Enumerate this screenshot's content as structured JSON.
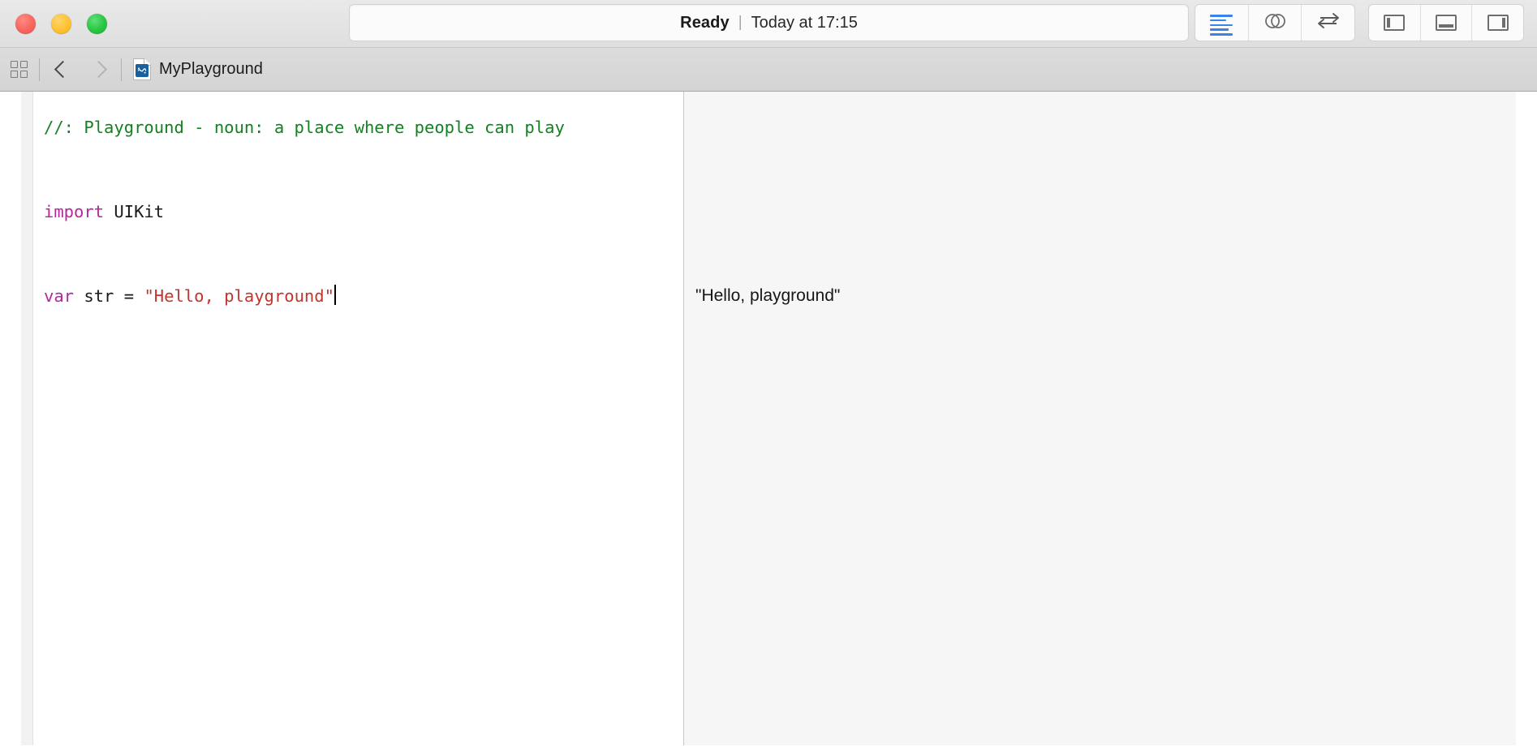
{
  "window": {
    "traffic_lights": [
      {
        "name": "close",
        "color": "#f7645c",
        "label": "Close"
      },
      {
        "name": "minimize",
        "color": "#fec12f",
        "label": "Minimize"
      },
      {
        "name": "zoom",
        "color": "#28c53f",
        "label": "Zoom"
      }
    ]
  },
  "toolbar": {
    "status": {
      "main": "Ready",
      "separator": "|",
      "sub": "Today at 17:15"
    },
    "editor_buttons": [
      {
        "icon": "standard-editor-icon",
        "label": "Standard Editor",
        "active": true
      },
      {
        "icon": "assistant-editor-icon",
        "label": "Assistant Editor",
        "active": false
      },
      {
        "icon": "version-editor-icon",
        "label": "Version Editor",
        "active": false
      }
    ],
    "panel_buttons": [
      {
        "icon": "navigator-panel-icon",
        "label": "Hide or show the Navigator"
      },
      {
        "icon": "debug-panel-icon",
        "label": "Hide or show the Debug area"
      },
      {
        "icon": "utilities-panel-icon",
        "label": "Hide or show the Utilities"
      }
    ]
  },
  "jumpbar": {
    "related_items_icon": "grid-icon",
    "back_label": "Back",
    "forward_label": "Forward",
    "file_icon": "playground-file-icon",
    "breadcrumb": "MyPlayground"
  },
  "editor": {
    "language": "Swift",
    "lines": [
      {
        "n": 1,
        "tokens": [
          {
            "type": "comment",
            "text": "//: Playground - noun: a place where people can play"
          }
        ]
      },
      {
        "n": 2,
        "tokens": [
          {
            "type": "plain",
            "text": ""
          }
        ]
      },
      {
        "n": 3,
        "tokens": [
          {
            "type": "keyword",
            "text": "import"
          },
          {
            "type": "plain",
            "text": " UIKit"
          }
        ]
      },
      {
        "n": 4,
        "tokens": [
          {
            "type": "plain",
            "text": ""
          }
        ]
      },
      {
        "n": 5,
        "tokens": [
          {
            "type": "keyword",
            "text": "var"
          },
          {
            "type": "plain",
            "text": " str = "
          },
          {
            "type": "string",
            "text": "\"Hello, playground\""
          }
        ],
        "caret": true
      }
    ],
    "syntax_colors": {
      "comment": "#12821f",
      "keyword": "#b5279c",
      "string": "#c2342e",
      "plain": "#1a1a1a",
      "background": "#ffffff"
    }
  },
  "results": {
    "background": "#f6f6f6",
    "lines": [
      "",
      "",
      "",
      "",
      "\"Hello, playground\""
    ]
  }
}
